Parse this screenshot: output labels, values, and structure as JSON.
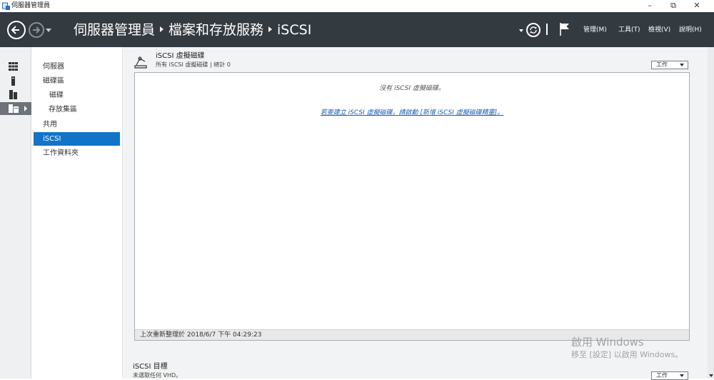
{
  "window": {
    "title": "伺服器管理員",
    "controls": {
      "minimize": "–",
      "restore": "⧉",
      "close": "✕"
    }
  },
  "header": {
    "breadcrumb": [
      "伺服器管理員",
      "檔案和存放服務",
      "iSCSI"
    ],
    "menus": [
      "管理(M)",
      "工具(T)",
      "檢視(V)",
      "說明(H)"
    ]
  },
  "left_rail": {
    "icons": [
      "dashboard-icon",
      "local-server-icon",
      "all-servers-icon",
      "file-storage-icon"
    ],
    "active_index": 3
  },
  "sidebar": {
    "items": [
      {
        "label": "伺服器",
        "level": 0
      },
      {
        "label": "磁碟區",
        "level": 0
      },
      {
        "label": "磁碟",
        "level": 1
      },
      {
        "label": "存放集區",
        "level": 1
      },
      {
        "label": "共用",
        "level": 0
      },
      {
        "label": "iSCSI",
        "level": 0,
        "active": true
      },
      {
        "label": "工作資料夾",
        "level": 0
      }
    ]
  },
  "virtual_disks": {
    "title": "iSCSI 虛擬磁碟",
    "subtitle": "所有 iSCSI 虛擬磁碟 | 總計 0",
    "tasks_label": "工作",
    "empty_message": "沒有 iSCSI 虛擬磁碟。",
    "create_link": "若要建立 iSCSI 虛擬磁碟，請啟動 [新增 iSCSI 虛擬磁碟精靈]。",
    "last_refreshed": "上次重新整理於 2018/6/7 下午 04:29:23"
  },
  "targets": {
    "title": "iSCSI 目標",
    "subtitle": "未選取任何 VHD。",
    "tasks_label": "工作"
  },
  "watermark": {
    "line1": "啟用 Windows",
    "line2": "移至 [設定] 以啟用 Windows。"
  },
  "colors": {
    "header_bg": "#333a40",
    "accent": "#1174c8",
    "link": "#1a5fb4"
  }
}
